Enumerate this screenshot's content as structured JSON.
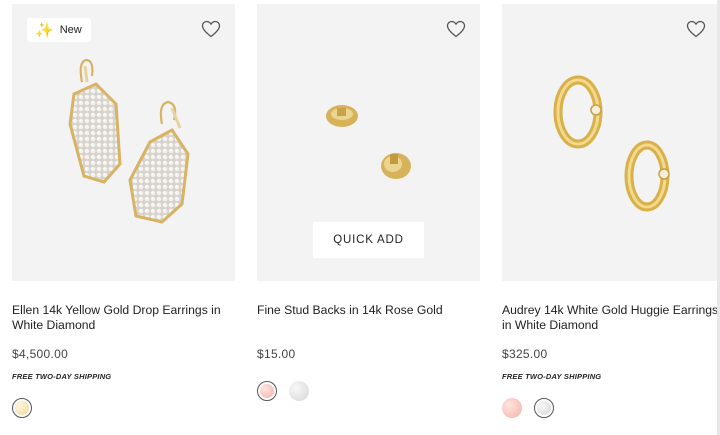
{
  "products": [
    {
      "badge": "New",
      "badge_icon": "sparkle-icon",
      "name": "Ellen 14k Yellow Gold Drop Earrings in White Diamond",
      "price": "$4,500.00",
      "shipping": "FREE TWO-DAY SHIPPING",
      "swatches": [
        "yellow-gold"
      ],
      "selected_swatch": "yellow-gold"
    },
    {
      "quick_add": "QUICK ADD",
      "name": "Fine Stud Backs in 14k Rose Gold",
      "price": "$15.00",
      "shipping": "",
      "swatches": [
        "rose-gold",
        "white-gold"
      ],
      "selected_swatch": "rose-gold"
    },
    {
      "name": "Audrey 14k White Gold Huggie Earrings in White Diamond",
      "price": "$325.00",
      "shipping": "FREE TWO-DAY SHIPPING",
      "swatches": [
        "rose-gold",
        "white-gold"
      ],
      "selected_swatch": "white-gold"
    }
  ],
  "colors": {
    "image_bg": "#f3f3f3",
    "gold": "#d9b45a",
    "heart_stroke": "#555555"
  }
}
